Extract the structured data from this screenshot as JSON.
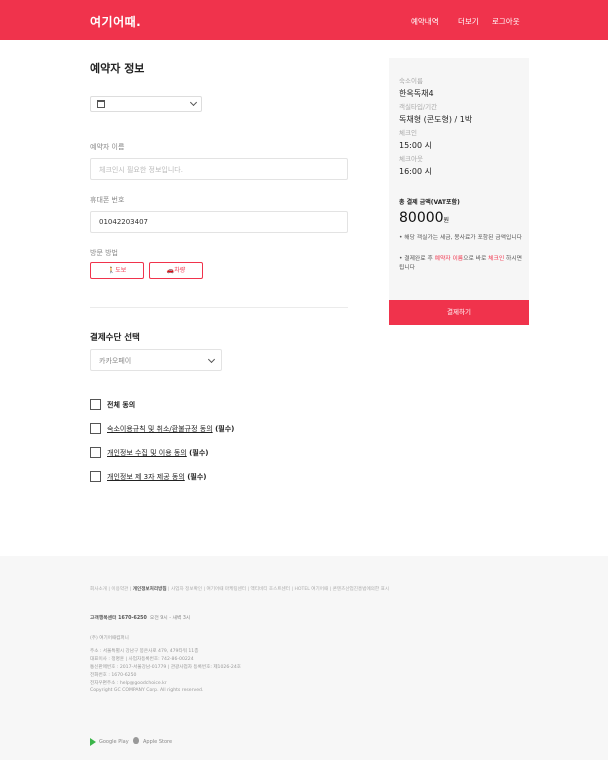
{
  "header": {
    "logo": "여기어때.",
    "nav": [
      "예약내역",
      "더보기",
      "로그아웃"
    ],
    "accent": "#f0334c"
  },
  "booking": {
    "title": "예약자 정보",
    "date_value": "",
    "name_label": "예약자 이름",
    "name_placeholder": "체크인시 필요한 정보입니다.",
    "phone_label": "휴대폰 번호",
    "phone_value": "01042203407",
    "visit_label": "방문 방법",
    "visit_options": [
      "도보",
      "차량"
    ]
  },
  "payment": {
    "title": "결제수단 선택",
    "method": "카카오페이"
  },
  "agreements": [
    {
      "pre": "",
      "link": "",
      "post": "전체 동의"
    },
    {
      "pre": "",
      "link": "숙소이용규칙 및 취소/환불규정 동의",
      "post": " (필수)"
    },
    {
      "pre": "",
      "link": "개인정보 수집 및 이용 동의",
      "post": " (필수)"
    },
    {
      "pre": "",
      "link": "개인정보 제 3자 제공 동의",
      "post": " (필수)"
    }
  ],
  "summary": {
    "stay_label": "숙소이름",
    "stay_value": "한옥독채4",
    "room_label": "객실타입/기간",
    "room_value": "독채형 (콘도형) / 1박",
    "checkin_label": "체크인",
    "checkin_value": "15:00 시",
    "checkout_label": "체크아웃",
    "checkout_value": "16:00 시",
    "total_label": "총 결제 금액(VAT포함)",
    "total_value": "80000",
    "currency": "원",
    "note1": "해당 객실가는 세금, 봉사료가 포함된 금액입니다",
    "note2_pre": "결제완료 후 ",
    "note2_red1": "예약자 이름",
    "note2_mid": "으로 바로 ",
    "note2_red2": "체크인",
    "note2_post": " 하시면 됩니다",
    "pay_button": "결제하기"
  },
  "footer": {
    "links_pre": "회사소개 | 이용약관 | ",
    "links_bold": "개인정보처리방침",
    "links_post": " | 사업자 정보확인 | 여기어때 마케팅센터 | 액티비티 호스트센터 | HOTEL 여기어때 | 콘텐츠산업진흥법에의한 표시",
    "cs_label": "고객행복센터 1670-6250",
    "cs_hours": "오전 9시 - 새벽 3시",
    "company": "(주) 여기어때컴퍼니",
    "info": [
      "주소 : 서울특별시 강남구 봉은사로 479, 479타워 11층",
      "대표이사 : 정명훈 | 사업자등록번호: 742-86-00224",
      "통신판매번호 : 2017-서울강남-01779 | 관광사업자 등록번호: 제1026-24호",
      "전화번호 : 1670-6250",
      "전자우편주소 : help@goodchoice.kr",
      "Copyright GC COMPANY Corp. All rights reserved."
    ],
    "stores": [
      "Google Play",
      "Apple Store"
    ]
  }
}
